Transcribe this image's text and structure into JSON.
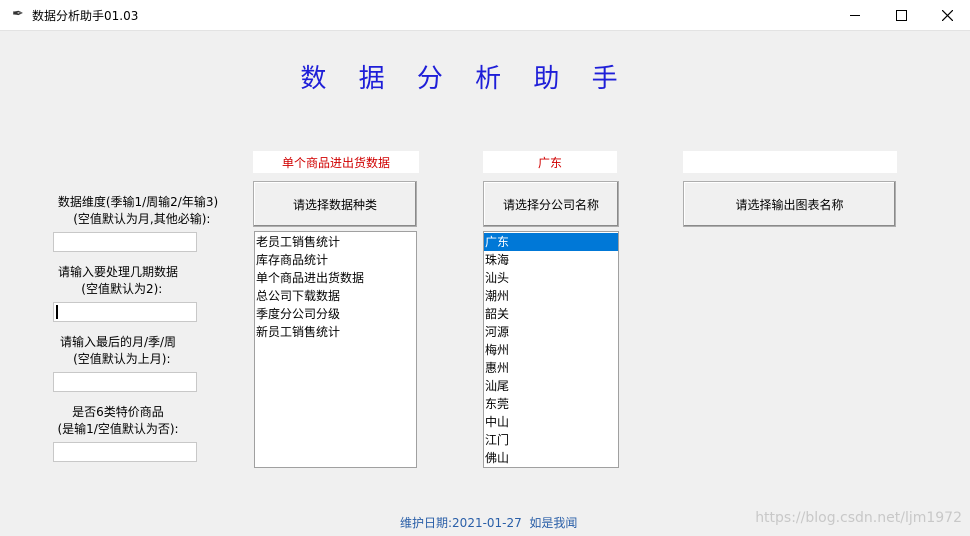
{
  "window": {
    "title": "数据分析助手01.03",
    "minimize_icon": "minimize-icon",
    "maximize_icon": "maximize-icon",
    "close_icon": "close-icon"
  },
  "heading": "数 据 分 析 助 手",
  "fields": [
    {
      "label": "数据维度(季输1/周输2/年输3)\n  (空值默认为月,其他必输):",
      "value": ""
    },
    {
      "label": "请输入要处理几期数据\n  (空值默认为2):",
      "value": ""
    },
    {
      "label": "请输入最后的月/季/周\n  (空值默认为上月):",
      "value": ""
    },
    {
      "label": "是否6类特价商品\n(是输1/空值默认为否):",
      "value": ""
    }
  ],
  "columns": {
    "data_type": {
      "selected_display": "单个商品进出货数据",
      "button": "请选择数据种类",
      "items": [
        "老员工销售统计",
        "库存商品统计",
        "单个商品进出货数据",
        "总公司下载数据",
        "季度分公司分级",
        "新员工销售统计"
      ]
    },
    "branch": {
      "selected_display": "广东",
      "button": "请选择分公司名称",
      "items": [
        "广东",
        "珠海",
        "汕头",
        "潮州",
        "韶关",
        "河源",
        "梅州",
        "惠州",
        "汕尾",
        "东莞",
        "中山",
        "江门",
        "佛山"
      ],
      "selected_index": 0
    },
    "chart": {
      "selected_display": "",
      "button": "请选择输出图表名称"
    }
  },
  "footer": "维护日期:2021-01-27  如是我闻",
  "watermark": "https://blog.csdn.net/ljm1972",
  "colors": {
    "heading": "#1e1ed8",
    "selected_text": "#d00000",
    "selection": "#0078d7"
  }
}
